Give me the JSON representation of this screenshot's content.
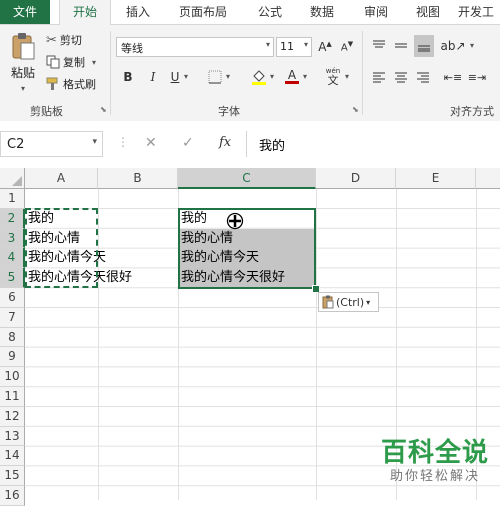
{
  "tabs": [
    "文件",
    "开始",
    "插入",
    "页面布局",
    "公式",
    "数据",
    "审阅",
    "视图",
    "开发工"
  ],
  "clipboard": {
    "paste_label": "粘贴",
    "cut_label": "剪切",
    "copy_label": "复制",
    "format_painter_label": "格式刷",
    "group_label": "剪贴板"
  },
  "font": {
    "font_name": "等线",
    "font_size": "11",
    "bold": "B",
    "italic": "I",
    "underline": "U",
    "wen": "wén",
    "wen_char": "文",
    "group_label": "字体"
  },
  "alignment": {
    "group_label": "对齐方式"
  },
  "formula_bar": {
    "name_box": "C2",
    "fx": "fx",
    "value": "我的"
  },
  "columns": [
    "A",
    "B",
    "C",
    "D",
    "E"
  ],
  "rows": [
    "1",
    "2",
    "3",
    "4",
    "5",
    "6",
    "7",
    "8",
    "9",
    "10",
    "11",
    "12",
    "13",
    "14",
    "15",
    "16"
  ],
  "cells": {
    "A2": "我的",
    "A3": "我的心情",
    "A4": "我的心情今天",
    "A5": "我的心情今天很好",
    "C2": "我的",
    "C3": "我的心情",
    "C4": "我的心情今天",
    "C5": "我的心情今天很好"
  },
  "paste_options": {
    "label": "(Ctrl)"
  },
  "watermark": {
    "title": "百科全说",
    "subtitle": "助你轻松解决"
  },
  "colors": {
    "accent": "#217346",
    "selection_fill": "#c5c5c5",
    "font_color": "#c00000",
    "highlight": "#ffff00"
  }
}
